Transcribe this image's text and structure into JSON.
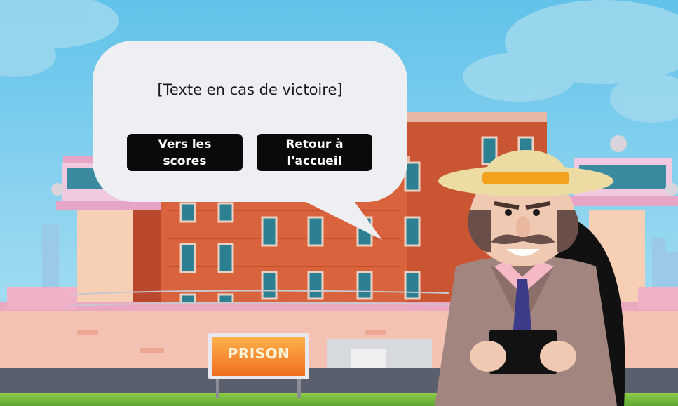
{
  "dialog": {
    "message": "[Texte en cas de victoire]",
    "buttons": [
      {
        "label": "Vers les\nscores"
      },
      {
        "label": "Retour à\nl'accueil"
      }
    ]
  },
  "scene": {
    "sign_text": "PRISON"
  },
  "colors": {
    "sky": "#66c6ea",
    "bubble": "#eeeff2",
    "button": "#0a0a0a",
    "brick": "#d9633c",
    "sign": "#f28a2e",
    "hat_band": "#f3a21e"
  }
}
